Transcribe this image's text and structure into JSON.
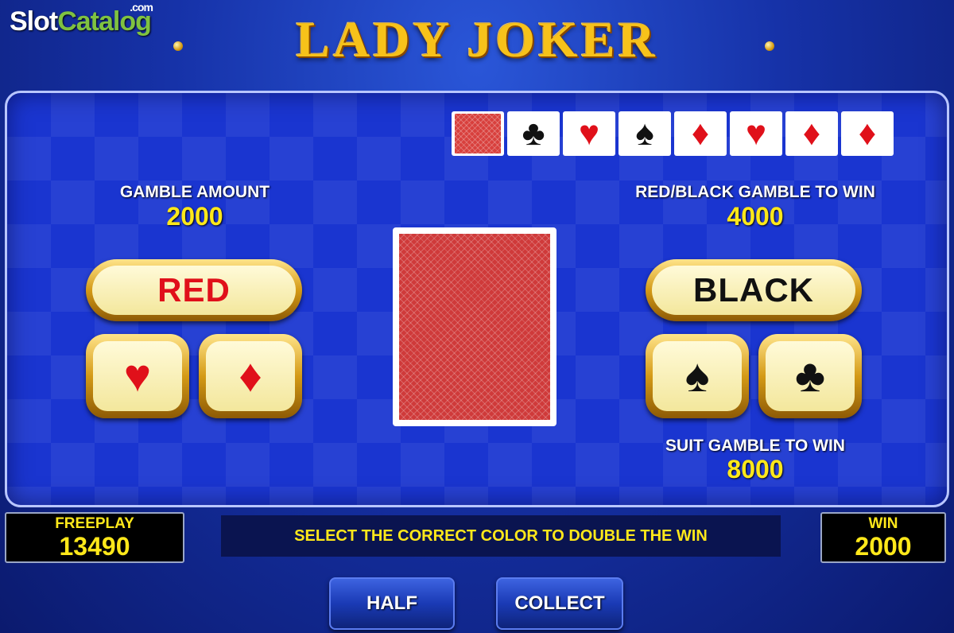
{
  "watermark": {
    "part1": "Slot",
    "part2": "Catalog",
    "suffix": ".com"
  },
  "title": "LADY JOKER",
  "history": [
    {
      "type": "back"
    },
    {
      "suit": "♣",
      "color": "black",
      "icon": "club-icon"
    },
    {
      "suit": "♥",
      "color": "red",
      "icon": "heart-icon"
    },
    {
      "suit": "♠",
      "color": "black",
      "icon": "spade-icon"
    },
    {
      "suit": "♦",
      "color": "red",
      "icon": "diamond-icon"
    },
    {
      "suit": "♥",
      "color": "red",
      "icon": "heart-icon"
    },
    {
      "suit": "♦",
      "color": "red",
      "icon": "diamond-icon"
    },
    {
      "suit": "♦",
      "color": "red",
      "icon": "diamond-icon"
    }
  ],
  "gamble_amount": {
    "label": "GAMBLE AMOUNT",
    "value": "2000"
  },
  "red_black": {
    "label": "RED/BLACK GAMBLE TO WIN",
    "value": "4000"
  },
  "suit_gamble": {
    "label": "SUIT GAMBLE TO WIN",
    "value": "8000"
  },
  "buttons": {
    "red": "RED",
    "black": "BLACK",
    "heart": "♥",
    "diamond": "♦",
    "spade": "♠",
    "club": "♣",
    "half": "HALF",
    "collect": "COLLECT"
  },
  "freeplay": {
    "label": "FREEPLAY",
    "value": "13490"
  },
  "win": {
    "label": "WIN",
    "value": "2000"
  },
  "message": "SELECT THE CORRECT COLOR TO DOUBLE THE WIN",
  "colors": {
    "red_suit": "#e0101a",
    "black_suit": "#111111",
    "value_yellow": "#ffe81a",
    "panel_blue": "#1a35d0"
  }
}
